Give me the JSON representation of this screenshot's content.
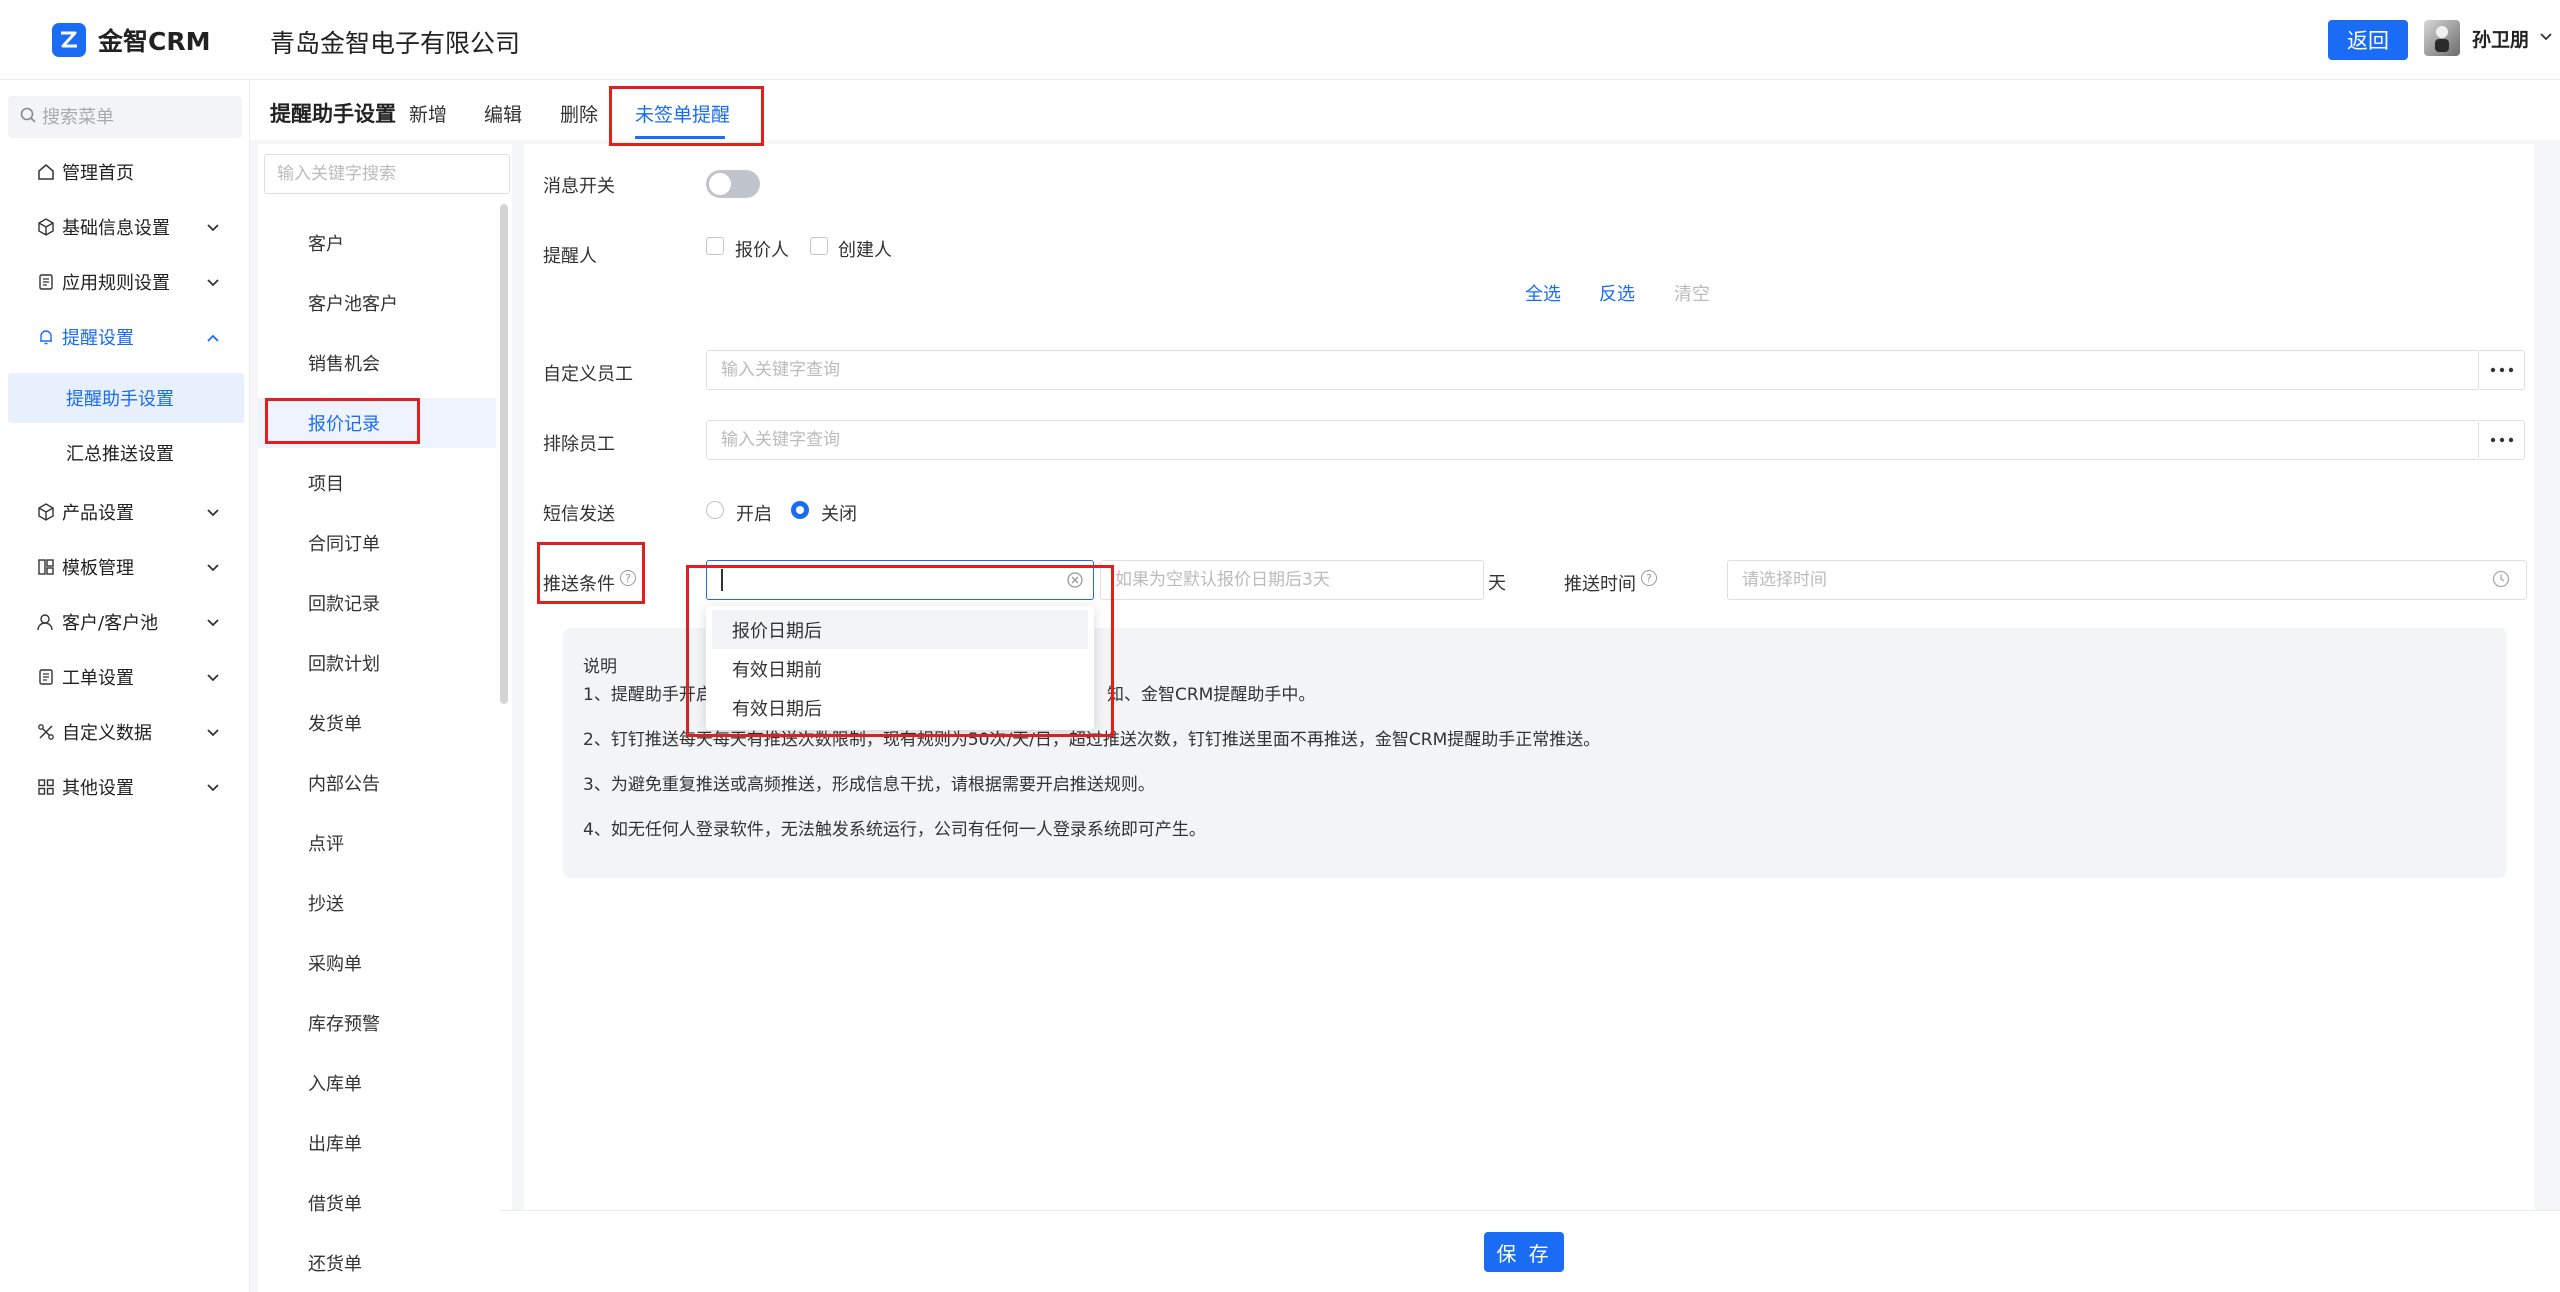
{
  "header": {
    "app_name": "金智CRM",
    "company": "青岛金智电子有限公司",
    "back_label": "返回",
    "user_name": "孙卫朋"
  },
  "sidebar": {
    "search_placeholder": "搜索菜单",
    "items": [
      {
        "label": "管理首页",
        "icon": "home-icon"
      },
      {
        "label": "基础信息设置",
        "icon": "cube-icon"
      },
      {
        "label": "应用规则设置",
        "icon": "document-icon"
      },
      {
        "label": "提醒设置",
        "icon": "bell-icon"
      },
      {
        "label": "产品设置",
        "icon": "cube-icon"
      },
      {
        "label": "模板管理",
        "icon": "template-icon"
      },
      {
        "label": "客户/客户池",
        "icon": "user-icon"
      },
      {
        "label": "工单设置",
        "icon": "document-icon"
      },
      {
        "label": "自定义数据",
        "icon": "tools-icon"
      },
      {
        "label": "其他设置",
        "icon": "grid-icon"
      }
    ],
    "sub_items": [
      "提醒助手设置",
      "汇总推送设置"
    ]
  },
  "tabs": {
    "title": "提醒助手设置",
    "items": [
      "新增",
      "编辑",
      "删除",
      "未签单提醒"
    ]
  },
  "categories": {
    "search_placeholder": "输入关键字搜索",
    "items": [
      "客户",
      "客户池客户",
      "销售机会",
      "报价记录",
      "项目",
      "合同订单",
      "回款记录",
      "回款计划",
      "发货单",
      "内部公告",
      "点评",
      "抄送",
      "采购单",
      "库存预警",
      "入库单",
      "出库单",
      "借货单",
      "还货单"
    ]
  },
  "form": {
    "msg_switch_label": "消息开关",
    "reminder_label": "提醒人",
    "check_quoter": "报价人",
    "check_creator": "创建人",
    "select_all": "全选",
    "invert": "反选",
    "clear": "清空",
    "custom_staff_label": "自定义员工",
    "exclude_staff_label": "排除员工",
    "keyword_placeholder": "输入关键字查询",
    "sms_label": "短信发送",
    "sms_on": "开启",
    "sms_off": "关闭",
    "push_condition_label": "推送条件",
    "days_placeholder": "如果为空默认报价日期后3天",
    "days_unit": "天",
    "push_time_label": "推送时间",
    "push_time_placeholder": "请选择时间",
    "dropdown_options": [
      "报价日期后",
      "有效日期前",
      "有效日期后"
    ]
  },
  "notes": {
    "title": "说明",
    "lines": [
      "1、提醒助手开启",
      "知、金智CRM提醒助手中。",
      "2、钉钉推送每天每天有推送次数限制，现有规则为50次/天/日，超过推送次数，钉钉推送里面不再推送，金智CRM提醒助手正常推送。",
      "3、为避免重复推送或高频推送，形成信息干扰，请根据需要开启推送规则。",
      "4、如无任何人登录软件，无法触发系统运行，公司有任何一人登录系统即可产生。"
    ]
  },
  "footer": {
    "save_label": "保 存"
  },
  "colors": {
    "accent": "#1a6cf5",
    "highlight": "#e0201f"
  }
}
